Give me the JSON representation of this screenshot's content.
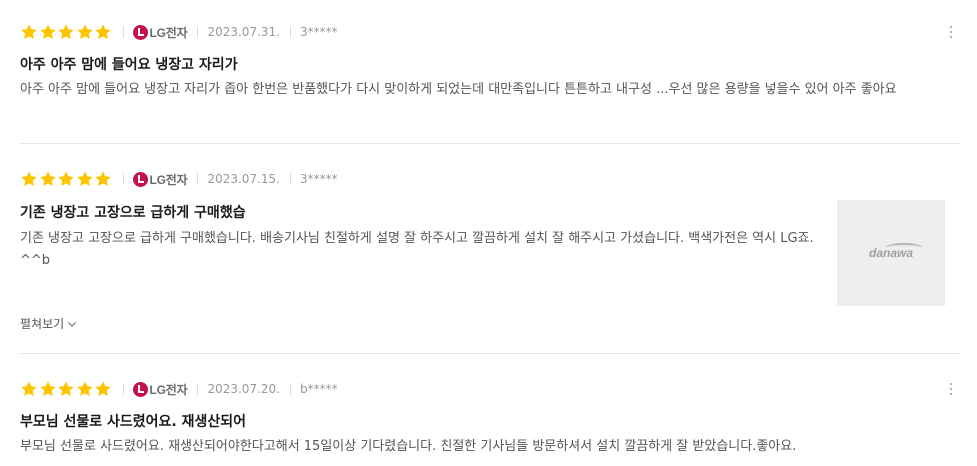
{
  "colors": {
    "star": "#ffc400",
    "lg_brand": "#c4114f"
  },
  "reviews": [
    {
      "rating": 5,
      "shop": "LG전자",
      "date": "2023.07.31.",
      "user": "3*****",
      "title": "아주 아주 맘에 들어요 냉장고 자리가",
      "body": "아주 아주 맘에 들어요 냉장고 자리가 좁아 한번은 반품했다가 다시 맞이하게 되었는데 대만족입니다 튼튼하고 내구성 ...우선 많은 용량을 넣을수 있어 아주 좋아요"
    },
    {
      "rating": 5,
      "shop": "LG전자",
      "date": "2023.07.15.",
      "user": "3*****",
      "title": "기존 냉장고 고장으로 급하게 구매했습",
      "body": "기존 냉장고 고장으로 급하게 구매했습니다. 배송기사님 친절하게 설명 잘 하주시고 깔끔하게 설치 잘 해주시고 가셨습니다. 백색가전은 역시 LG죠. ^^b",
      "thumbnail": "danawa",
      "more_label": "펼쳐보기"
    },
    {
      "rating": 5,
      "shop": "LG전자",
      "date": "2023.07.20.",
      "user": "b*****",
      "title": "부모님 선물로 사드렸어요. 재생산되어",
      "body": "부모님 선물로 사드렸어요. 재생산되어야한다고해서 15일이상 기다렸습니다. 친절한 기사님들 방문하셔서 설치 깔끔하게 잘 받았습니다.좋아요."
    }
  ]
}
